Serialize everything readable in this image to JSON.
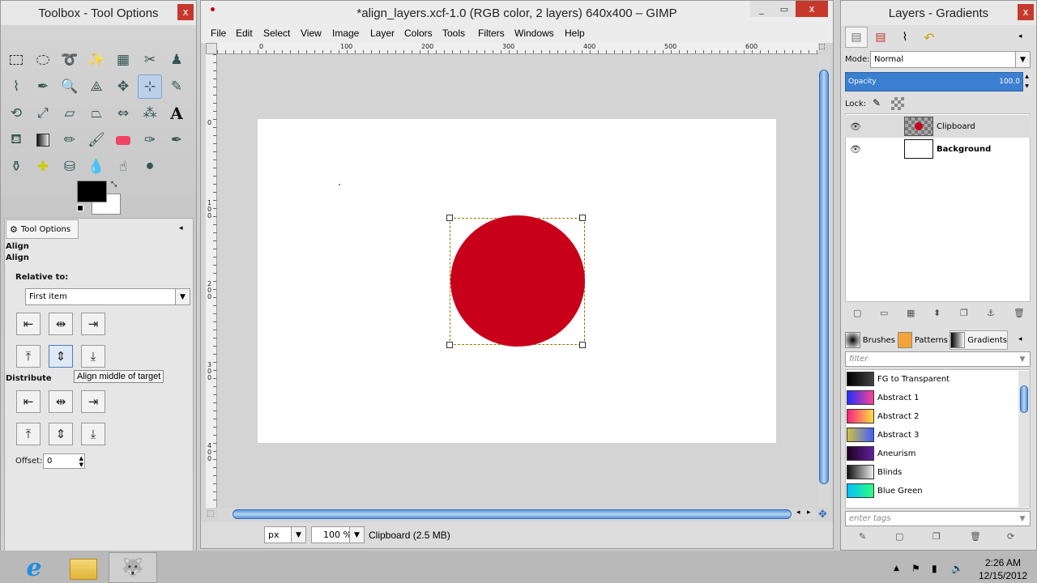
{
  "toolbox": {
    "title": "Toolbox - Tool Options",
    "close_label": "x",
    "tool_options_tab": "Tool Options",
    "section_title": "Align",
    "section_subtitle": "Align",
    "relative_to_label": "Relative to:",
    "relative_to_value": "First item",
    "tooltip": "Align middle of target",
    "distribute_label": "Distribute",
    "offset_label": "Offset:",
    "offset_value": "0"
  },
  "image_window": {
    "title": "*align_layers.xcf-1.0 (RGB color, 2 layers) 640x400 – GIMP",
    "menu": [
      "File",
      "Edit",
      "Select",
      "View",
      "Image",
      "Layer",
      "Colors",
      "Tools",
      "Filters",
      "Windows",
      "Help"
    ],
    "ruler_h_labels": [
      "0",
      "100",
      "200",
      "300",
      "400",
      "500",
      "600"
    ],
    "ruler_v_labels": [
      "0",
      "1\n0\n0",
      "2\n0\n0",
      "3\n0\n0",
      "4\n0\n0"
    ],
    "unit": "px",
    "zoom": "100 %",
    "status": "Clipboard (2.5 MB)",
    "circle_color": "#c8001a"
  },
  "layers": {
    "title": "Layers - Gradients",
    "mode_label": "Mode:",
    "mode_value": "Normal",
    "opacity_label": "Opacity",
    "opacity_value": "100.0",
    "lock_label": "Lock:",
    "items": [
      {
        "name": "Clipboard"
      },
      {
        "name": "Background"
      }
    ]
  },
  "gradients": {
    "tabs": [
      "Brushes",
      "Patterns",
      "Gradients"
    ],
    "filter_placeholder": "filter",
    "tags_placeholder": "enter tags",
    "items": [
      {
        "name": "FG to Transparent",
        "colors": [
          "#000000",
          "#444444"
        ]
      },
      {
        "name": "Abstract 1",
        "colors": [
          "#2030ff",
          "#ff4090"
        ]
      },
      {
        "name": "Abstract 2",
        "colors": [
          "#ff2080",
          "#ffe040"
        ]
      },
      {
        "name": "Abstract 3",
        "colors": [
          "#d0c040",
          "#4060ff"
        ]
      },
      {
        "name": "Aneurism",
        "colors": [
          "#200020",
          "#6020a0"
        ]
      },
      {
        "name": "Blinds",
        "colors": [
          "#111111",
          "#eeeeee"
        ]
      },
      {
        "name": "Blue Green",
        "colors": [
          "#00c0ff",
          "#30ff80"
        ]
      }
    ]
  },
  "taskbar": {
    "time": "2:26 AM",
    "date": "12/15/2012"
  }
}
